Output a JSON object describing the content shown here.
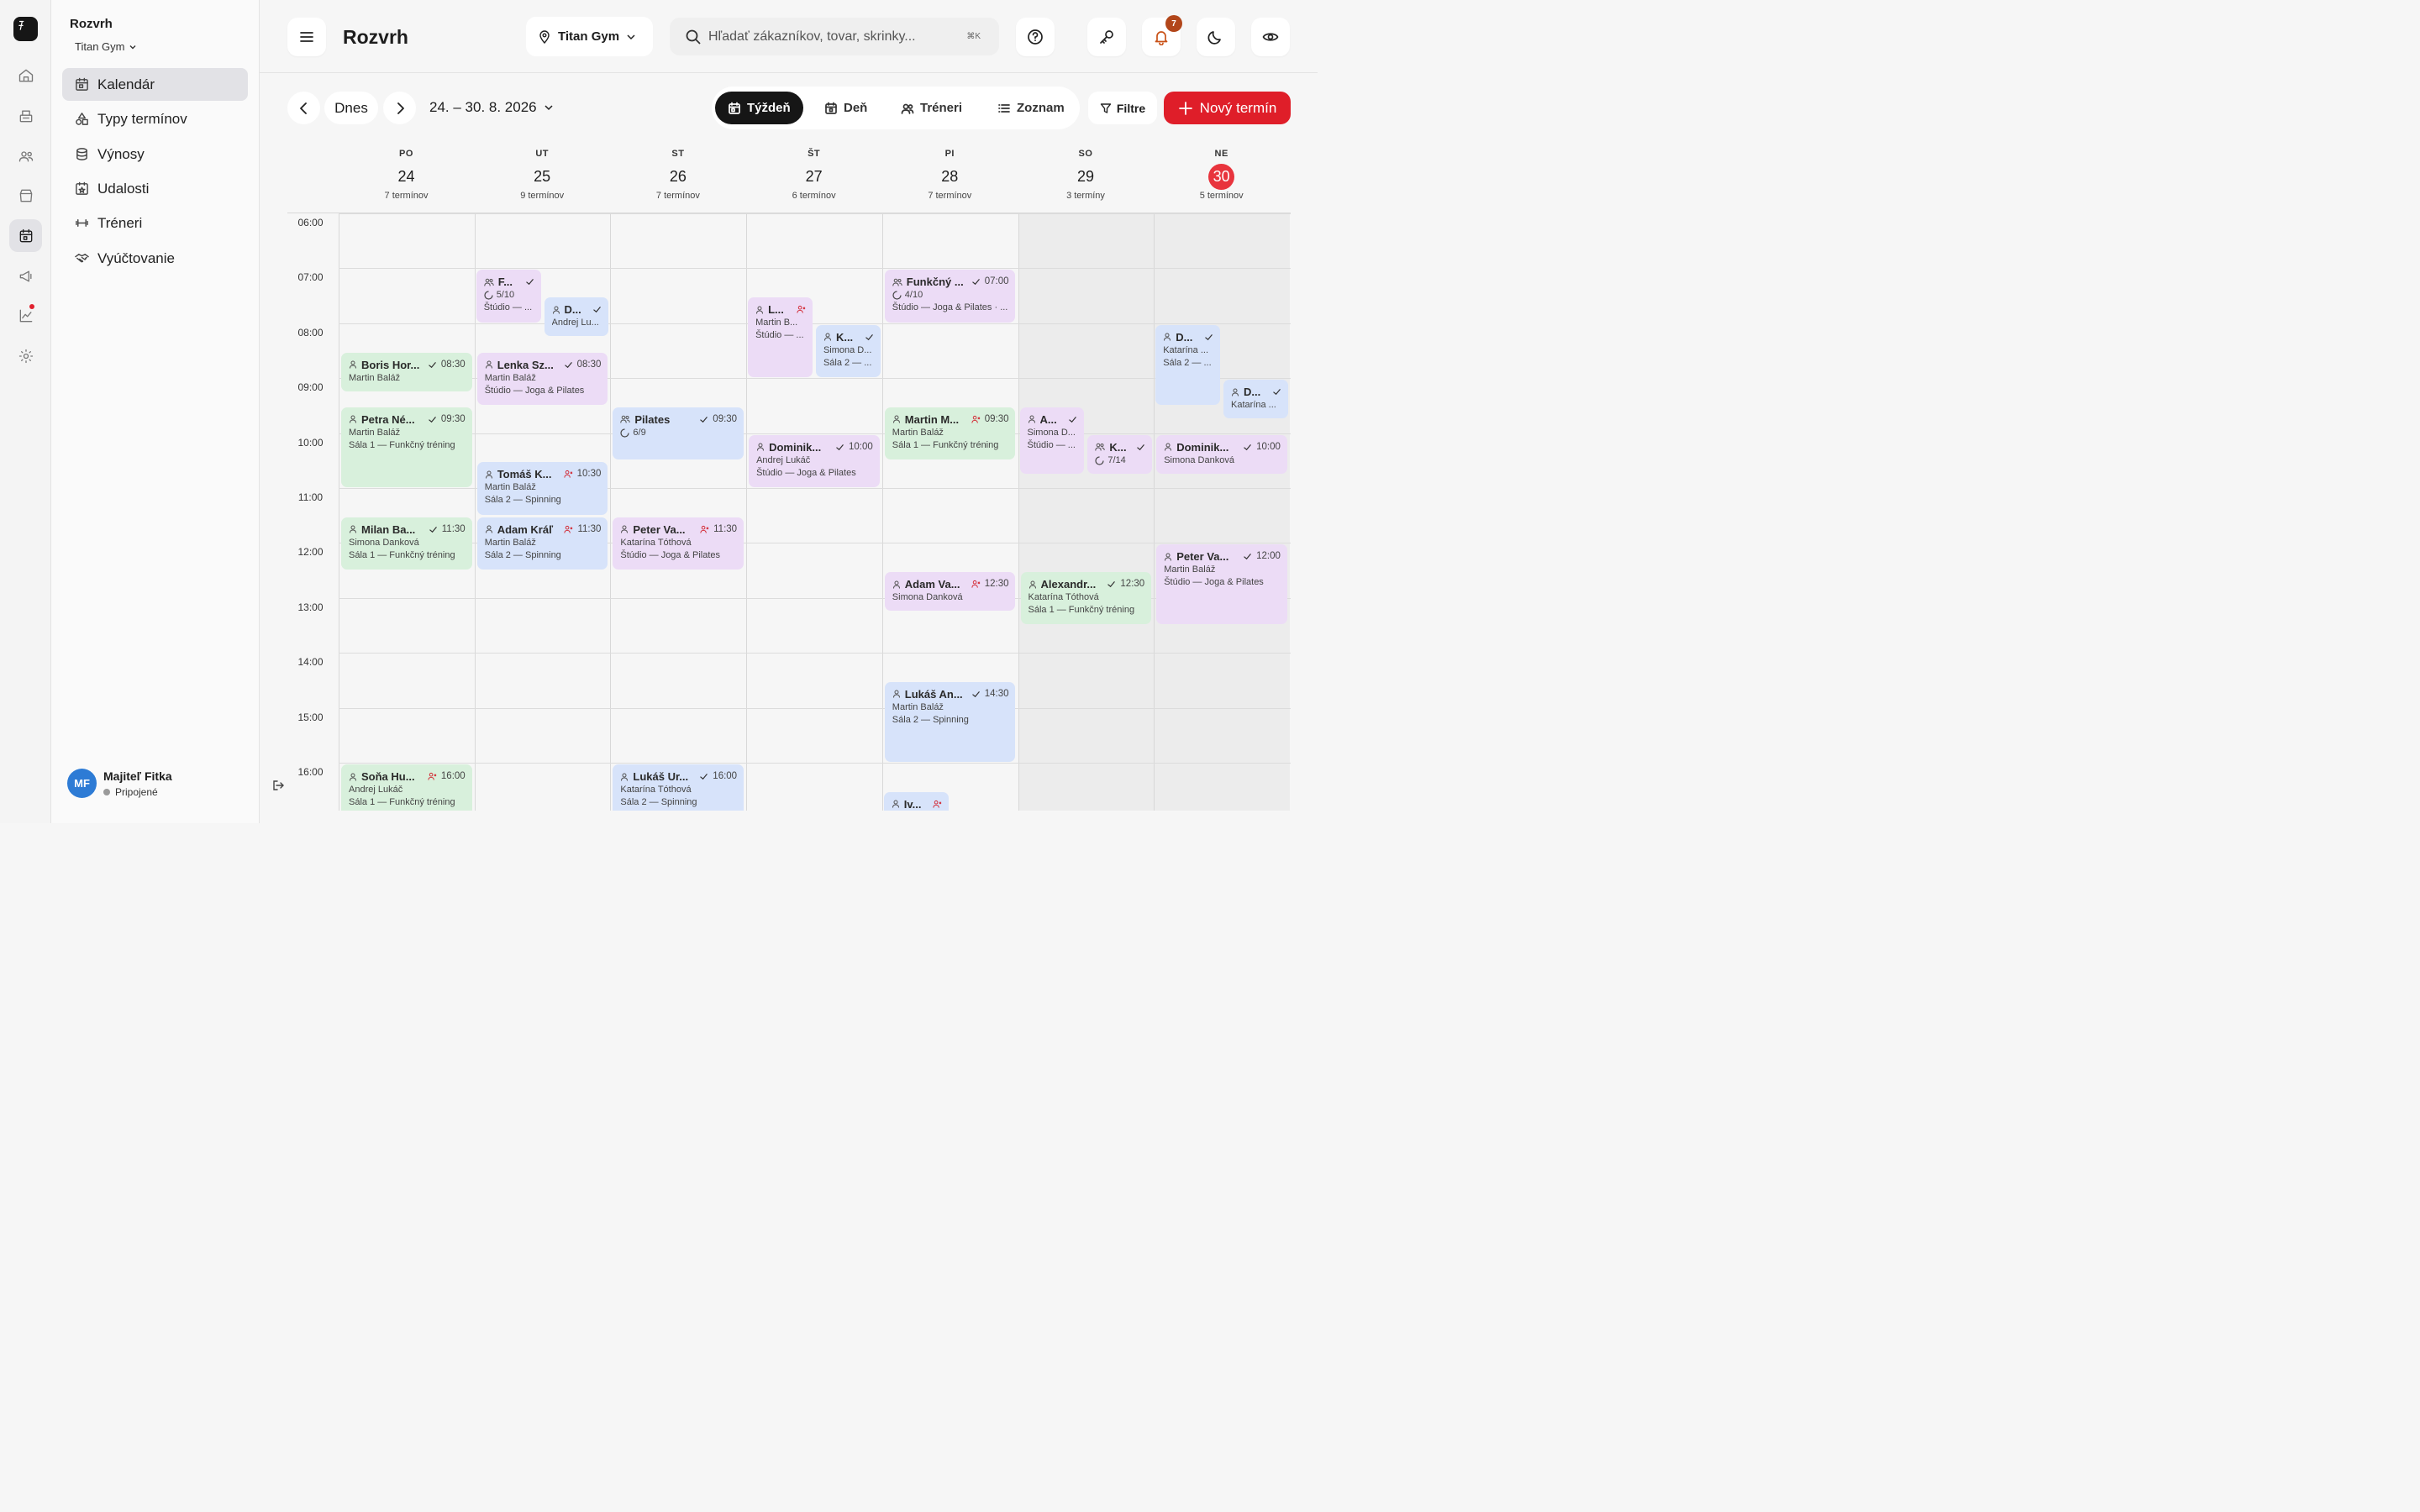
{
  "sidebar": {
    "org": "Rozvrh",
    "gym": "Titan Gym",
    "nav": [
      {
        "label": "Kalendár",
        "icon": "calendar-icon"
      },
      {
        "label": "Typy termínov",
        "icon": "shapes-icon"
      },
      {
        "label": "Výnosy",
        "icon": "coins-icon"
      },
      {
        "label": "Udalosti",
        "icon": "calendar-star-icon"
      },
      {
        "label": "Tréneri",
        "icon": "dumbbell-icon"
      },
      {
        "label": "Vyúčtovanie",
        "icon": "handshake-icon"
      }
    ],
    "user": {
      "initials": "MF",
      "name": "Majiteľ Fitka",
      "status": "Pripojené"
    }
  },
  "header": {
    "title": "Rozvrh",
    "location": "Titan Gym",
    "search_placeholder": "Hľadať zákazníkov, tovar, skrinky...",
    "search_shortcut": "⌘K",
    "notifications": "7"
  },
  "toolbar": {
    "today": "Dnes",
    "range": "24. – 30. 8. 2026",
    "views": [
      "Týždeň",
      "Deň",
      "Tréneri",
      "Zoznam"
    ],
    "active_view": "Týždeň",
    "filter": "Filtre",
    "new": "Nový termín"
  },
  "days": [
    {
      "name": "PO",
      "date": "24",
      "count": "7 termínov"
    },
    {
      "name": "UT",
      "date": "25",
      "count": "9 termínov"
    },
    {
      "name": "ST",
      "date": "26",
      "count": "7 termínov"
    },
    {
      "name": "ŠT",
      "date": "27",
      "count": "6 termínov"
    },
    {
      "name": "PI",
      "date": "28",
      "count": "7 termínov"
    },
    {
      "name": "SO",
      "date": "29",
      "count": "3 termíny"
    },
    {
      "name": "NE",
      "date": "30",
      "count": "5 termínov",
      "today": true
    }
  ],
  "hours": [
    "06:00",
    "07:00",
    "08:00",
    "09:00",
    "10:00",
    "11:00",
    "12:00",
    "13:00",
    "14:00",
    "15:00",
    "16:00"
  ],
  "colors": {
    "green": "#d8f0dc",
    "purple": "#ecdcf6",
    "blue": "#d7e3fa",
    "accent": "#df1e29",
    "today": "#e8343d"
  },
  "events": [
    {
      "day": 0,
      "start": "08:30",
      "end": "09:15",
      "lane": 0,
      "lanes": 1,
      "color": "green",
      "type": "person",
      "title": "Boris Hor...",
      "status": "check",
      "time": "08:30",
      "lines": [
        "Martin Baláž"
      ]
    },
    {
      "day": 0,
      "start": "09:30",
      "end": "11:00",
      "lane": 0,
      "lanes": 1,
      "color": "green",
      "type": "person",
      "title": "Petra Né...",
      "status": "check",
      "time": "09:30",
      "lines": [
        "Martin Baláž",
        "Sála 1 — Funkčný tréning"
      ]
    },
    {
      "day": 0,
      "start": "11:30",
      "end": "12:30",
      "lane": 0,
      "lanes": 1,
      "color": "green",
      "type": "person",
      "title": "Milan Ba...",
      "status": "check",
      "time": "11:30",
      "lines": [
        "Simona Danková",
        "Sála 1 — Funkčný tréning"
      ]
    },
    {
      "day": 0,
      "start": "16:00",
      "end": "17:00",
      "lane": 0,
      "lanes": 1,
      "color": "green",
      "type": "person",
      "title": "Soňa Hu...",
      "status": "user",
      "time": "16:00",
      "lines": [
        "Andrej Lukáč",
        "Sála 1 — Funkčný tréning"
      ]
    },
    {
      "day": 1,
      "start": "07:00",
      "end": "08:00",
      "lane": 0,
      "lanes": 2,
      "color": "purple",
      "type": "group",
      "title": "F...",
      "status": "check",
      "time": "",
      "cap": "5/10",
      "lines": [
        "Štúdio — ..."
      ]
    },
    {
      "day": 1,
      "start": "07:30",
      "end": "08:15",
      "lane": 1,
      "lanes": 2,
      "color": "blue",
      "type": "person",
      "title": "D...",
      "status": "check",
      "time": "",
      "lines": [
        "Andrej Lu..."
      ]
    },
    {
      "day": 1,
      "start": "08:30",
      "end": "09:30",
      "lane": 0,
      "lanes": 1,
      "color": "purple",
      "type": "person",
      "title": "Lenka Sz...",
      "status": "check",
      "time": "08:30",
      "lines": [
        "Martin Baláž",
        "Štúdio — Joga & Pilates"
      ]
    },
    {
      "day": 1,
      "start": "10:30",
      "end": "11:30",
      "lane": 0,
      "lanes": 1,
      "color": "blue",
      "type": "person",
      "title": "Tomáš K...",
      "status": "user",
      "time": "10:30",
      "lines": [
        "Martin Baláž",
        "Sála 2 — Spinning"
      ]
    },
    {
      "day": 1,
      "start": "11:30",
      "end": "12:30",
      "lane": 0,
      "lanes": 1,
      "color": "blue",
      "type": "person",
      "title": "Adam Kráľ",
      "status": "user",
      "time": "11:30",
      "lines": [
        "Martin Baláž",
        "Sála 2 — Spinning"
      ]
    },
    {
      "day": 2,
      "start": "09:30",
      "end": "10:30",
      "lane": 0,
      "lanes": 1,
      "color": "blue",
      "type": "group",
      "title": "Pilates",
      "status": "check",
      "time": "09:30",
      "cap": "6/9",
      "lines": []
    },
    {
      "day": 2,
      "start": "11:30",
      "end": "12:30",
      "lane": 0,
      "lanes": 1,
      "color": "purple",
      "type": "person",
      "title": "Peter Va...",
      "status": "user",
      "time": "11:30",
      "lines": [
        "Katarína Tóthová",
        "Štúdio — Joga & Pilates"
      ]
    },
    {
      "day": 2,
      "start": "16:00",
      "end": "17:00",
      "lane": 0,
      "lanes": 1,
      "color": "blue",
      "type": "person",
      "title": "Lukáš Ur...",
      "status": "check",
      "time": "16:00",
      "lines": [
        "Katarína Tóthová",
        "Sála 2 — Spinning"
      ]
    },
    {
      "day": 3,
      "start": "07:30",
      "end": "09:00",
      "lane": 0,
      "lanes": 2,
      "color": "purple",
      "type": "person",
      "title": "L...",
      "status": "user",
      "time": "",
      "lines": [
        "Martin B...",
        "Štúdio — ..."
      ]
    },
    {
      "day": 3,
      "start": "08:00",
      "end": "09:00",
      "lane": 1,
      "lanes": 2,
      "color": "blue",
      "type": "person",
      "title": "K...",
      "status": "check",
      "time": "",
      "lines": [
        "Simona D...",
        "Sála 2 — ..."
      ]
    },
    {
      "day": 3,
      "start": "10:00",
      "end": "11:00",
      "lane": 0,
      "lanes": 1,
      "color": "purple",
      "type": "person",
      "title": "Dominik...",
      "status": "check",
      "time": "10:00",
      "lines": [
        "Andrej Lukáč",
        "Štúdio — Joga & Pilates"
      ]
    },
    {
      "day": 4,
      "start": "07:00",
      "end": "08:00",
      "lane": 0,
      "lanes": 1,
      "color": "purple",
      "type": "group",
      "title": "Funkčný ...",
      "status": "check",
      "time": "07:00",
      "cap": "4/10",
      "lines": [
        "Štúdio — Joga & Pilates · ..."
      ]
    },
    {
      "day": 4,
      "start": "09:30",
      "end": "10:30",
      "lane": 0,
      "lanes": 1,
      "color": "green",
      "type": "person",
      "title": "Martin M...",
      "status": "user",
      "time": "09:30",
      "lines": [
        "Martin Baláž",
        "Sála 1 — Funkčný tréning"
      ]
    },
    {
      "day": 4,
      "start": "12:30",
      "end": "13:15",
      "lane": 0,
      "lanes": 1,
      "color": "purple",
      "type": "person",
      "title": "Adam Va...",
      "status": "user",
      "time": "12:30",
      "lines": [
        "Simona Danková"
      ]
    },
    {
      "day": 4,
      "start": "14:30",
      "end": "16:00",
      "lane": 0,
      "lanes": 1,
      "color": "blue",
      "type": "person",
      "title": "Lukáš An...",
      "status": "check",
      "time": "14:30",
      "lines": [
        "Martin Baláž",
        "Sála 2 — Spinning"
      ]
    },
    {
      "day": 4,
      "start": "16:30",
      "end": "17:00",
      "lane": 0,
      "lanes": 2,
      "color": "blue",
      "type": "person",
      "title": "Iv...",
      "status": "user",
      "time": "",
      "lines": []
    },
    {
      "day": 5,
      "start": "09:30",
      "end": "10:45",
      "lane": 0,
      "lanes": 2,
      "color": "purple",
      "type": "person",
      "title": "A...",
      "status": "check",
      "time": "",
      "lines": [
        "Simona D...",
        "Štúdio — ..."
      ]
    },
    {
      "day": 5,
      "start": "10:00",
      "end": "10:45",
      "lane": 1,
      "lanes": 2,
      "color": "purple",
      "type": "group",
      "title": "K...",
      "status": "check",
      "time": "",
      "cap": "7/14",
      "lines": []
    },
    {
      "day": 5,
      "start": "12:30",
      "end": "13:30",
      "lane": 0,
      "lanes": 1,
      "color": "green",
      "type": "person",
      "title": "Alexandr...",
      "status": "check",
      "time": "12:30",
      "lines": [
        "Katarína Tóthová",
        "Sála 1 — Funkčný tréning"
      ]
    },
    {
      "day": 6,
      "start": "08:00",
      "end": "09:30",
      "lane": 0,
      "lanes": 2,
      "color": "blue",
      "type": "person",
      "title": "D...",
      "status": "check",
      "time": "",
      "lines": [
        "Katarína ...",
        "Sála 2 — ..."
      ]
    },
    {
      "day": 6,
      "start": "09:00",
      "end": "09:45",
      "lane": 1,
      "lanes": 2,
      "color": "blue",
      "type": "person",
      "title": "D...",
      "status": "check",
      "time": "",
      "lines": [
        "Katarína ..."
      ]
    },
    {
      "day": 6,
      "start": "10:00",
      "end": "10:45",
      "lane": 0,
      "lanes": 1,
      "color": "purple",
      "type": "person",
      "title": "Dominik...",
      "status": "check",
      "time": "10:00",
      "lines": [
        "Simona Danková"
      ]
    },
    {
      "day": 6,
      "start": "12:00",
      "end": "13:30",
      "lane": 0,
      "lanes": 1,
      "color": "purple",
      "type": "person",
      "title": "Peter Va...",
      "status": "check",
      "time": "12:00",
      "lines": [
        "Martin Baláž",
        "Štúdio — Joga & Pilates"
      ]
    }
  ]
}
